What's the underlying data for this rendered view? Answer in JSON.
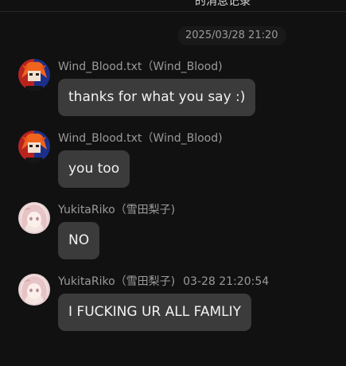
{
  "header": {
    "title": "的消息记录"
  },
  "date_divider": "2025/03/28 21:20",
  "colors": {
    "background": "#111111",
    "bubble": "#3b3b3b",
    "meta_text": "#9a9a9a"
  },
  "messages": [
    {
      "sender": "Wind_Blood.txt（Wind_Blood)",
      "time": "",
      "text": "thanks for what you say :)",
      "avatar": "orange-hair-character-avatar"
    },
    {
      "sender": "Wind_Blood.txt（Wind_Blood)",
      "time": "",
      "text": "you too",
      "avatar": "orange-hair-character-avatar"
    },
    {
      "sender": "YukitaRiko（雪田梨子)",
      "time": "",
      "text": "NO",
      "avatar": "pink-anime-girl-avatar"
    },
    {
      "sender": "YukitaRiko（雪田梨子)",
      "time": "03-28 21:20:54",
      "text": "I FUCKING UR ALL FAMLIY",
      "avatar": "pink-anime-girl-avatar"
    }
  ]
}
